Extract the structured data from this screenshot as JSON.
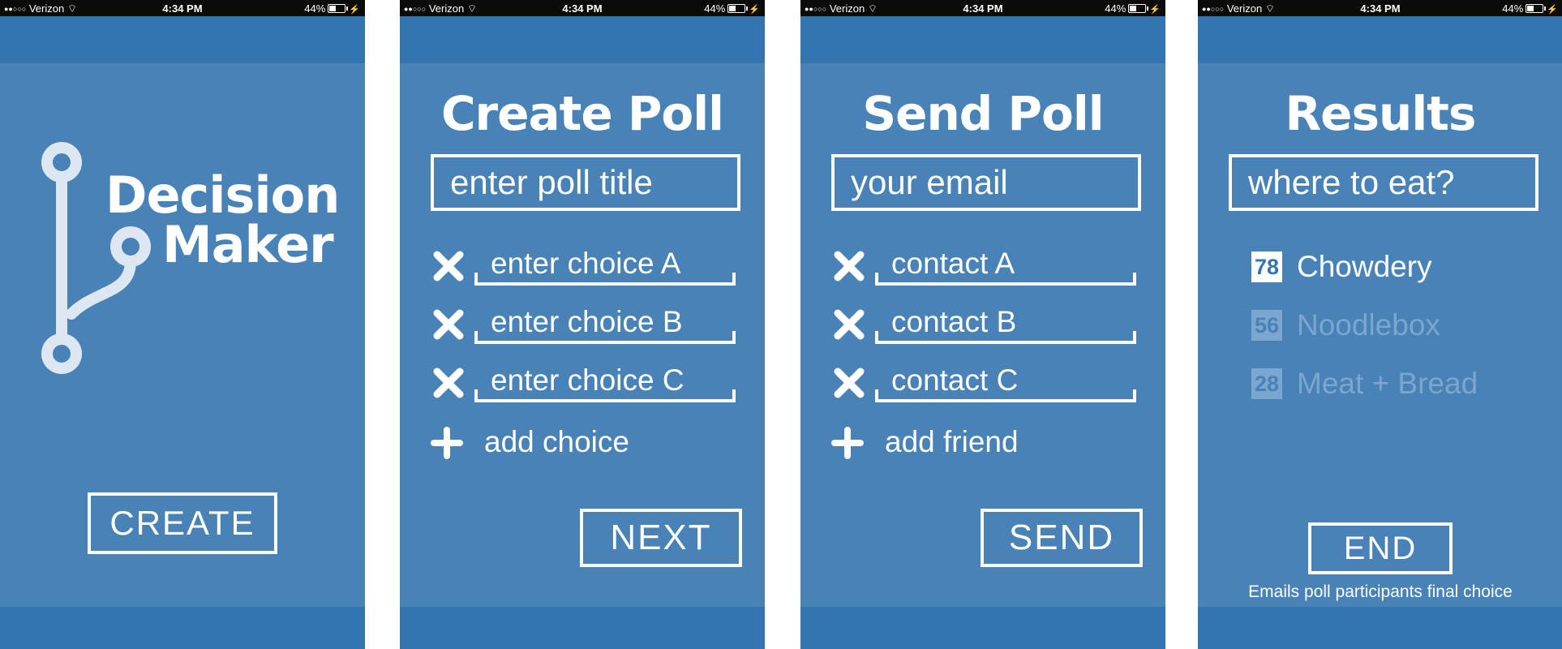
{
  "status_bar": {
    "signal": "●●○○○",
    "carrier": "Verizon",
    "wifi": "wifi-icon",
    "time": "4:34 PM",
    "battery": "44%"
  },
  "screens": {
    "home": {
      "logo_line1": "Decision",
      "logo_line2": "Maker",
      "create_button": "CREATE"
    },
    "create_poll": {
      "title": "Create Poll",
      "poll_title_placeholder": "enter poll title",
      "choices": [
        "enter choice A",
        "enter choice B",
        "enter choice C"
      ],
      "add_label": "add choice",
      "next_button": "NEXT"
    },
    "send_poll": {
      "title": "Send Poll",
      "email_placeholder": "your email",
      "contacts": [
        "contact A",
        "contact B",
        "contact C"
      ],
      "add_label": "add friend",
      "send_button": "SEND"
    },
    "results": {
      "title": "Results",
      "poll_name": "where to eat?",
      "results": [
        {
          "count": "78",
          "label": "Chowdery"
        },
        {
          "count": "56",
          "label": "Noodlebox"
        },
        {
          "count": "28",
          "label": "Meat + Bread"
        }
      ],
      "end_button": "END",
      "footnote": "Emails poll participants final choice"
    }
  },
  "colors": {
    "background": "#4882b7",
    "bars": "#3375b0",
    "text": "#ffffff",
    "faded_text": "#7aa6d0"
  }
}
